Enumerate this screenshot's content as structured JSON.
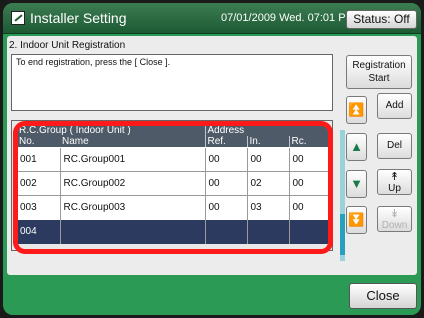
{
  "header": {
    "title": "Installer Setting",
    "datetime": "07/01/2009 Wed. 07:01 PM",
    "status_label": "Status: Off"
  },
  "section_title": "2. Indoor Unit Registration",
  "message": "To end registration, press the [ Close ].",
  "table": {
    "group_header": "R.C.Group ( Indoor Unit )",
    "address_header": "Address",
    "columns": {
      "no": "No.",
      "name": "Name",
      "ref": "Ref.",
      "in": "In.",
      "rc": "Rc."
    },
    "rows": [
      {
        "no": "001",
        "name": "RC.Group001",
        "ref": "00",
        "in": "00",
        "rc": "00"
      },
      {
        "no": "002",
        "name": "RC.Group002",
        "ref": "00",
        "in": "02",
        "rc": "00"
      },
      {
        "no": "003",
        "name": "RC.Group003",
        "ref": "00",
        "in": "03",
        "rc": "00"
      },
      {
        "no": "004",
        "name": "",
        "ref": "",
        "in": "",
        "rc": ""
      }
    ]
  },
  "buttons": {
    "registration_start": [
      "Registration",
      "Start"
    ],
    "add": "Add",
    "del": "Del",
    "up": "Up",
    "down": "Down",
    "close": "Close"
  },
  "icons": {
    "page_up": "page-up-icon",
    "line_up": "line-up-icon",
    "line_down": "line-down-icon",
    "page_down": "page-down-icon"
  },
  "colors": {
    "background": "#2b9a55",
    "titlebar": "#1c5a33",
    "header_row": "#4e5a67",
    "selected_row": "#2b3a5e",
    "highlight": "#ff1a1a",
    "accent": "#1a7a4a"
  }
}
